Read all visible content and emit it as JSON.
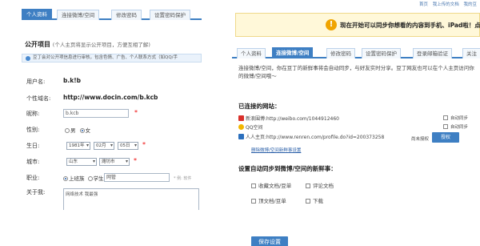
{
  "left": {
    "tabs": [
      "个人资料",
      "连接微博/空间",
      "修改密码",
      "设置密码保护"
    ],
    "section_title": "公开项目",
    "section_sub": "(个人主页将显示公开项目，方便互相了解)",
    "info_text": "豆丁会对公开项信息进行审核，包含色情、广告、个人联系方式（如QQ/手",
    "fields": {
      "username_label": "用户名:",
      "username_value": "b.k!b",
      "url_label": "个性域名:",
      "url_value": "http://www.docin.com/b.kcb",
      "nickname_label": "昵称:",
      "nickname_value": "b.kcb",
      "gender_label": "性别:",
      "gender_male": "男",
      "gender_female": "女",
      "birthday_label": "生日:",
      "year": "1981年",
      "month": "02月",
      "day": "05日",
      "city_label": "城市:",
      "province": "山东",
      "city": "潍坊市",
      "job_label": "职业:",
      "job_worker": "上班族",
      "job_student": "学生",
      "job_value": "网管",
      "job_hint": "* 例: 软件",
      "bio_label": "关于我:",
      "bio_value": "网络技术 我最强"
    },
    "required_mark": "*"
  },
  "right": {
    "top_links": [
      "首页",
      "我上传的文档",
      "我的豆"
    ],
    "notice_icon": "!",
    "notice_text": "现在开始可以同步你想看的内容到手机、iPad啦！点此了",
    "tabs": [
      "个人资料",
      "连接微博/空间",
      "修改密码",
      "设置密码保护",
      "登录邮箱验证",
      "关注"
    ],
    "description": "连接微博/空间，你在豆丁的新鲜事将会自动同步，与好友实时分享。豆丁网友也可以在个人主页访问你的微博/空间哦～",
    "connected_title": "已连接的网站：",
    "sites": [
      {
        "name": "新浪围博:http://weibo.com/1044912460",
        "color": "#d9302b"
      },
      {
        "name": "QQ空间",
        "color": "#f2b600"
      },
      {
        "name": "人人主页:http://www.renren.com/profile.do?id=200373258",
        "color": "#2b6fbd"
      }
    ],
    "sync_label": "自动同步",
    "auth_label": "尚未授权",
    "auth_button": "授权",
    "manage_link": "删除微博/空间新鲜事设置",
    "auto_title": "设置自动同步到微博/空间的新鲜事：",
    "options": [
      "收藏文档/豆单",
      "评论文档",
      "顶文档/豆单",
      "下载"
    ],
    "save_button": "保存设置"
  }
}
